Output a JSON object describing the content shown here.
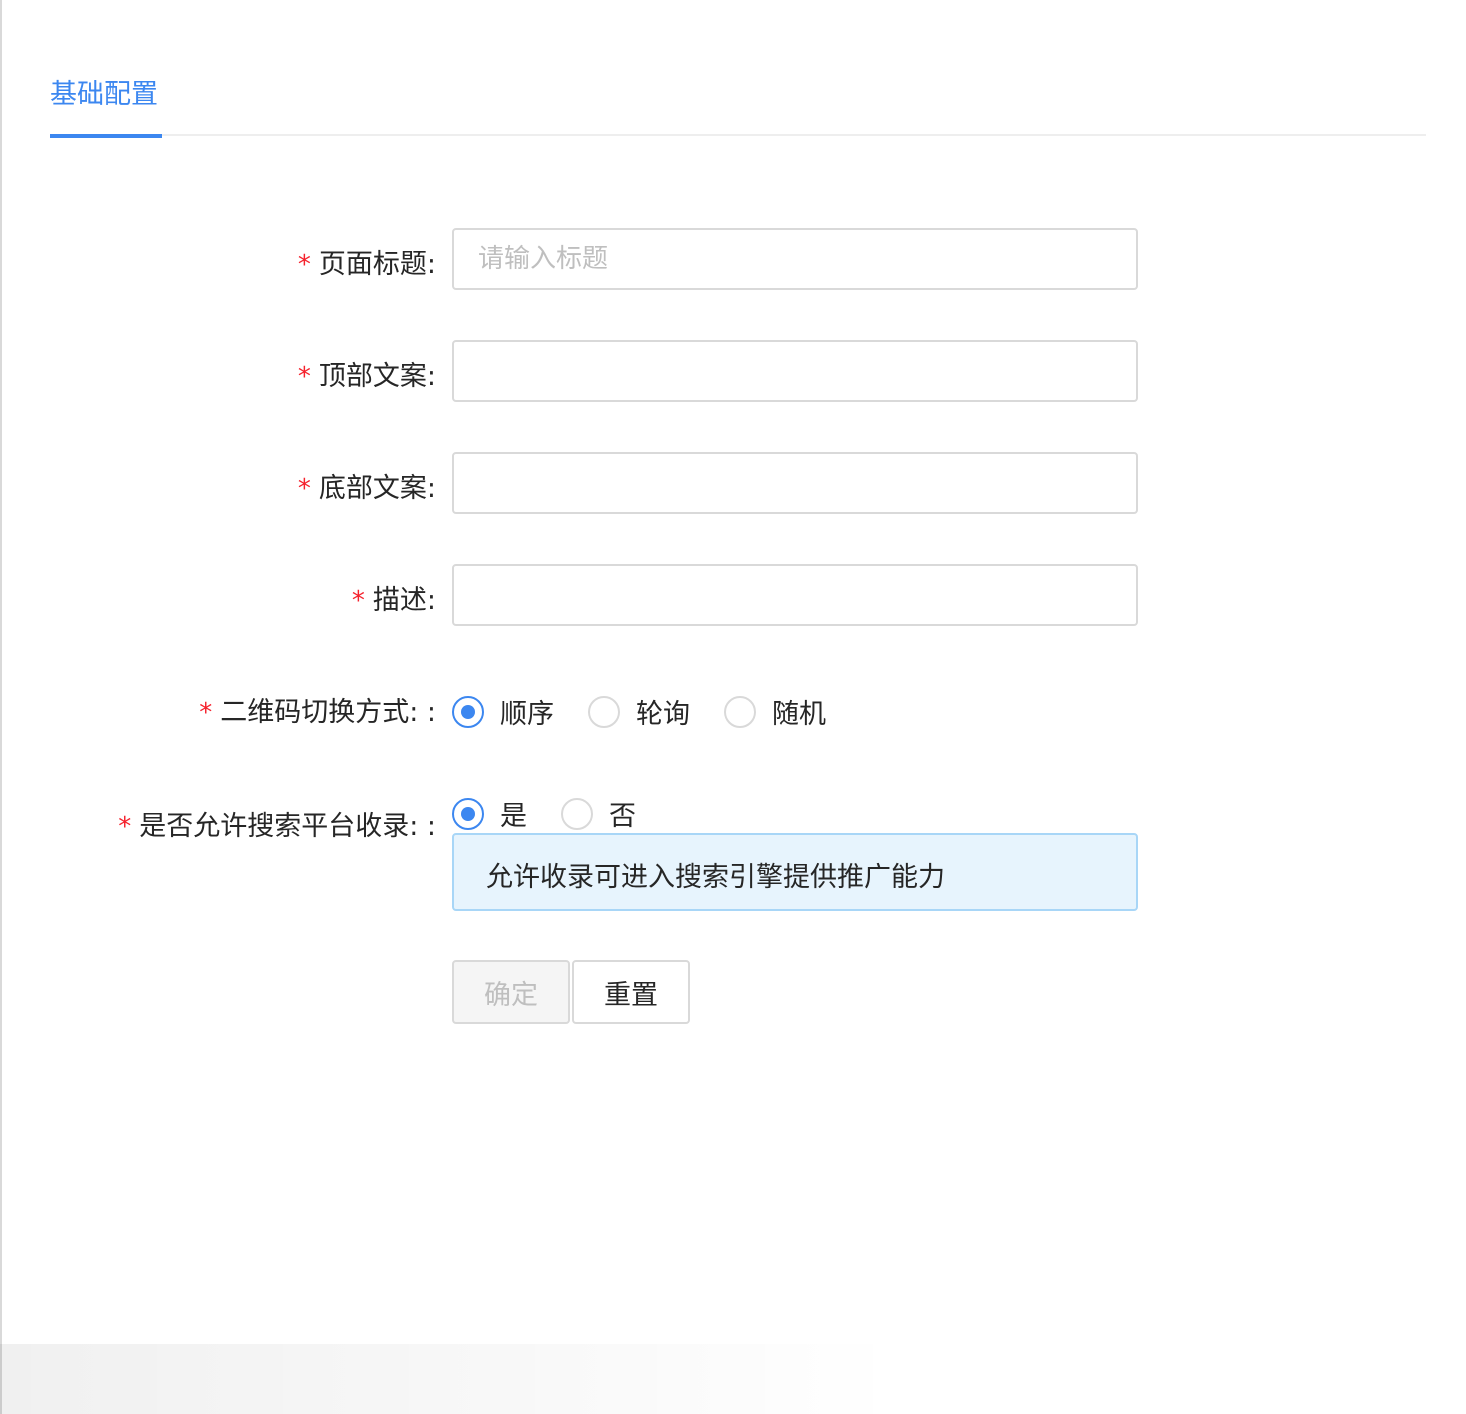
{
  "tabs": [
    {
      "label": "基础配置",
      "active": true
    }
  ],
  "form": {
    "page_title": {
      "label": "页面标题:",
      "placeholder": "请输入标题",
      "value": ""
    },
    "top_copy": {
      "label": "顶部文案:",
      "value": ""
    },
    "bottom_copy": {
      "label": "底部文案:",
      "value": ""
    },
    "description": {
      "label": "描述:",
      "value": ""
    },
    "qr_switch": {
      "label": "二维码切换方式: :",
      "options": [
        "顺序",
        "轮询",
        "随机"
      ],
      "selected": "顺序"
    },
    "allow_index": {
      "label": "是否允许搜索平台收录: :",
      "options": [
        "是",
        "否"
      ],
      "selected": "是",
      "notice": "允许收录可进入搜索引擎提供推广能力"
    },
    "required_mark": "*"
  },
  "buttons": {
    "confirm": "确定",
    "reset": "重置"
  },
  "colors": {
    "accent": "#3c87f0",
    "required": "#f5222d",
    "notice_bg": "#e7f4fd",
    "notice_border": "#a8d6f7"
  }
}
